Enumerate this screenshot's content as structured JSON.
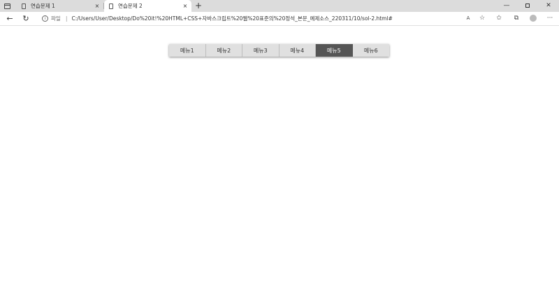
{
  "browser": {
    "tabs": [
      {
        "title": "연습문제 1",
        "active": false
      },
      {
        "title": "연습문제 2",
        "active": true
      }
    ],
    "close_glyph": "×",
    "new_tab_glyph": "+",
    "address": {
      "scheme_label": "파일",
      "separator": "|",
      "url": "C:/Users/User/Desktop/Do%20it!%20HTML+CSS+자바스크립트%20웹%20표준의%20정석_본문_예제소스_220311/10/sol-2.html#"
    },
    "icons": {
      "back": "arrow-left-icon",
      "reload": "reload-icon",
      "info": "info-icon",
      "read_aloud": "read-aloud-icon",
      "add_favorite": "star-plus-icon",
      "favorites": "favorites-icon",
      "collections": "collections-icon",
      "profile": "profile-icon",
      "more": "more-icon"
    },
    "read_aloud_label": "A",
    "more_label": "···"
  },
  "menu": {
    "items": [
      "메뉴1",
      "메뉴2",
      "메뉴3",
      "메뉴4",
      "메뉴5",
      "메뉴6"
    ],
    "active_index": 4,
    "colors": {
      "background": "#e0e0e0",
      "active_background": "#555555",
      "active_text": "#ffffff"
    }
  }
}
